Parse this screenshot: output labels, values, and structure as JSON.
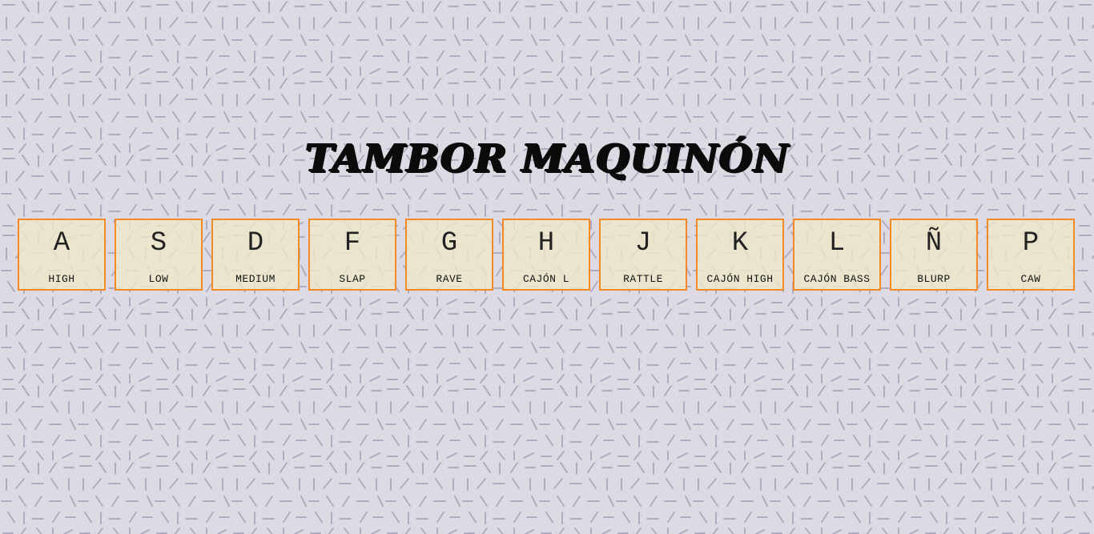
{
  "title": "TAMBOR MAQUINÓN",
  "colors": {
    "background": "#dddae3",
    "pattern_stroke": "#b1abc2",
    "key_border": "#f28b23",
    "key_fill": "#f0e8c8"
  },
  "keys": [
    {
      "letter": "A",
      "sound": "HIGH"
    },
    {
      "letter": "S",
      "sound": "LOW"
    },
    {
      "letter": "D",
      "sound": "MEDIUM"
    },
    {
      "letter": "F",
      "sound": "SLAP"
    },
    {
      "letter": "G",
      "sound": "RAVE"
    },
    {
      "letter": "H",
      "sound": "CAJÓN L"
    },
    {
      "letter": "J",
      "sound": "RATTLE"
    },
    {
      "letter": "K",
      "sound": "CAJÓN HIGH"
    },
    {
      "letter": "L",
      "sound": "CAJÓN BASS"
    },
    {
      "letter": "Ñ",
      "sound": "BLURP"
    },
    {
      "letter": "P",
      "sound": "CAW"
    }
  ]
}
